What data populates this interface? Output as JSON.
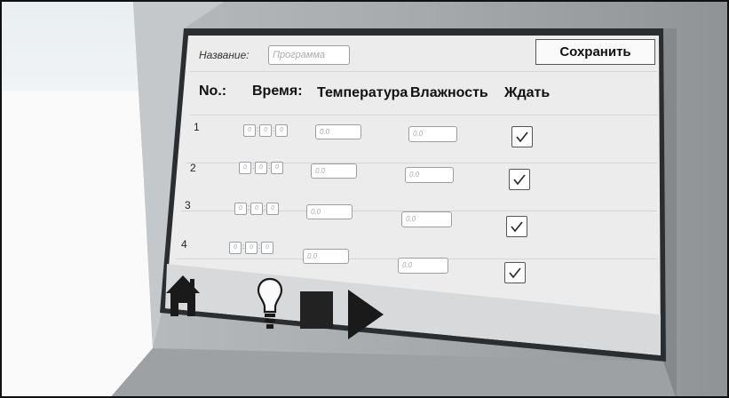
{
  "header": {
    "name_label": "Название:",
    "name_placeholder": "Программа",
    "save_label": "Сохранить"
  },
  "columns": {
    "no": "No.:",
    "time": "Время:",
    "temperature": "Температура",
    "humidity": "Влажность",
    "wait": "Ждать"
  },
  "rows": [
    {
      "num": "1",
      "h": "0",
      "m": "0",
      "s": "0",
      "temperature": "0.0",
      "humidity": "0.0",
      "wait": true
    },
    {
      "num": "2",
      "h": "0",
      "m": "0",
      "s": "0",
      "temperature": "0.0",
      "humidity": "0.0",
      "wait": true
    },
    {
      "num": "3",
      "h": "0",
      "m": "0",
      "s": "0",
      "temperature": "0.0",
      "humidity": "0.0",
      "wait": true
    },
    {
      "num": "4",
      "h": "0",
      "m": "0",
      "s": "0",
      "temperature": "0.0",
      "humidity": "0.0",
      "wait": true
    }
  ],
  "toolbar": {
    "home_icon": "home-icon",
    "light_icon": "lightbulb-icon",
    "stop_icon": "stop-icon",
    "play_icon": "play-icon"
  },
  "colors": {
    "bezel": "#a9adaf",
    "bezel_light": "#c7cacc",
    "screen": "#ececec",
    "toolbar": "#d8d9da",
    "icon": "#1a1a1a"
  }
}
